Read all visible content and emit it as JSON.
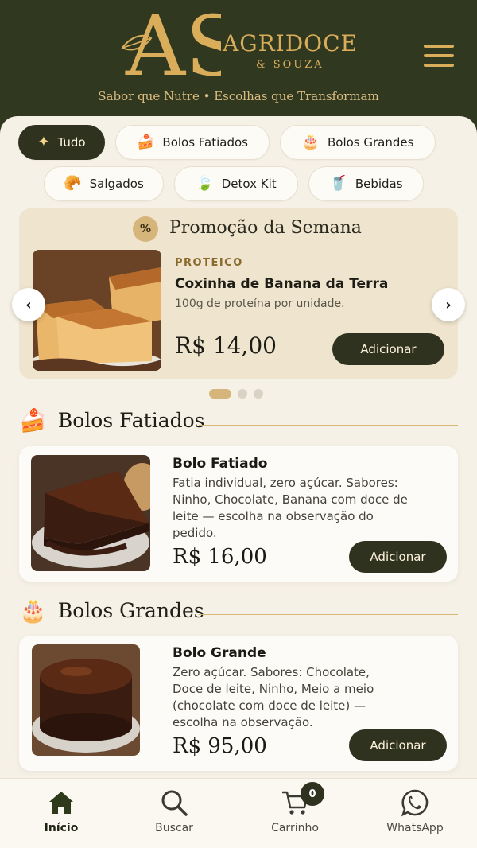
{
  "header": {
    "logo_letters": "AS",
    "brand_name": "AGRIDOCE",
    "brand_sub": "& SOUZA",
    "tagline": "Sabor que Nutre • Escolhas que Transformam",
    "accent_color": "#d9ad5a",
    "background_color": "#303820"
  },
  "categories": [
    {
      "label": "Tudo",
      "icon": "sparkle-icon",
      "glyph": "✦",
      "active": true
    },
    {
      "label": "Bolos Fatiados",
      "icon": "cake-slice-icon",
      "glyph": "🍰",
      "active": false
    },
    {
      "label": "Bolos Grandes",
      "icon": "birthday-cake-icon",
      "glyph": "🎂",
      "active": false
    },
    {
      "label": "Salgados",
      "icon": "croissant-icon",
      "glyph": "🥐",
      "active": false
    },
    {
      "label": "Detox Kit",
      "icon": "leaf-icon",
      "glyph": "🍃",
      "active": false
    },
    {
      "label": "Bebidas",
      "icon": "cup-icon",
      "glyph": "🥤",
      "active": false
    }
  ],
  "promo": {
    "badge": "%",
    "title": "Promoção da Semana",
    "kicker": "PROTEICO",
    "name": "Coxinha de Banana da Terra",
    "description": "100g de proteína por unidade.",
    "price": "R$ 14,00",
    "button": "Adicionar",
    "slides_total": 3,
    "slide_active": 1
  },
  "sections": [
    {
      "title": "Bolos Fatiados",
      "icon": "cake-slice-icon",
      "glyph": "🍰",
      "product": {
        "name": "Bolo Fatiado",
        "description": "Fatia individual, zero açúcar. Sabores: Ninho, Chocolate, Banana com doce de leite — escolha na observação do pedido.",
        "price": "R$ 16,00",
        "button": "Adicionar"
      }
    },
    {
      "title": "Bolos Grandes",
      "icon": "birthday-cake-icon",
      "glyph": "🎂",
      "product": {
        "name": "Bolo Grande",
        "description": "Zero açúcar. Sabores: Chocolate, Doce de leite, Ninho, Meio a meio (chocolate com doce de leite) — escolha na observação.",
        "price": "R$ 95,00",
        "button": "Adicionar"
      }
    }
  ],
  "bottom_nav": [
    {
      "label": "Início",
      "icon": "home-icon",
      "active": true
    },
    {
      "label": "Buscar",
      "icon": "search-icon",
      "active": false
    },
    {
      "label": "Carrinho",
      "icon": "cart-icon",
      "active": false,
      "badge": "0"
    },
    {
      "label": "WhatsApp",
      "icon": "whatsapp-icon",
      "active": false
    }
  ]
}
